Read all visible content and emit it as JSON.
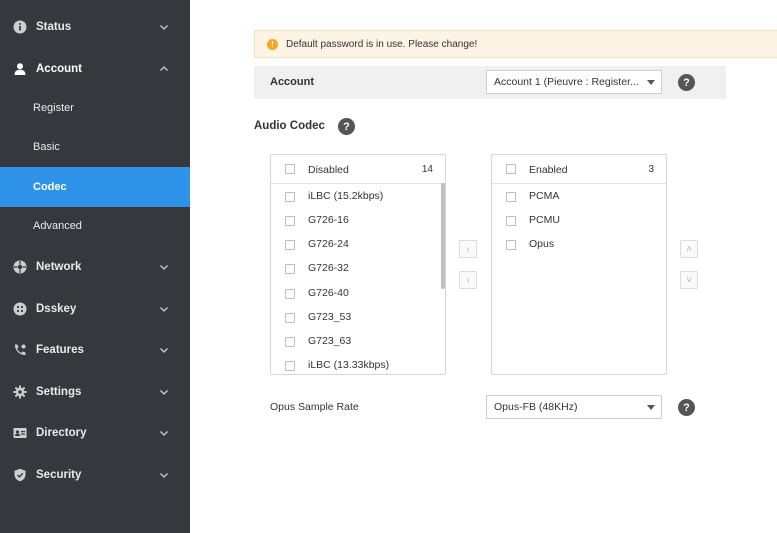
{
  "sidebar": {
    "items": [
      {
        "label": "Status",
        "icon": "info-icon"
      },
      {
        "label": "Account",
        "icon": "user-icon"
      },
      {
        "label": "Network",
        "icon": "network-icon"
      },
      {
        "label": "Dsskey",
        "icon": "dsskey-icon"
      },
      {
        "label": "Features",
        "icon": "phone-icon"
      },
      {
        "label": "Settings",
        "icon": "gear-icon"
      },
      {
        "label": "Directory",
        "icon": "directory-icon"
      },
      {
        "label": "Security",
        "icon": "shield-icon"
      }
    ],
    "account_sub": [
      {
        "label": "Register"
      },
      {
        "label": "Basic"
      },
      {
        "label": "Codec",
        "active": true
      },
      {
        "label": "Advanced"
      }
    ]
  },
  "notice": {
    "text": "Default password is in use. Please change!",
    "icon": "warning-icon",
    "color": "#f5a623"
  },
  "account": {
    "label": "Account",
    "selected": "Account 1 (Pieuvre : Register..."
  },
  "audio_codec": {
    "title": "Audio Codec",
    "disabled": {
      "title": "Disabled",
      "count": "14",
      "items": [
        "iLBC (15.2kbps)",
        "G726-16",
        "G726-24",
        "G726-32",
        "G726-40",
        "G723_53",
        "G723_63",
        "iLBC (13.33kbps)"
      ]
    },
    "enabled": {
      "title": "Enabled",
      "count": "3",
      "items": [
        "PCMA",
        "PCMU",
        "Opus"
      ]
    },
    "move_left": "‹",
    "move_right": "›",
    "move_up": "˄",
    "move_down": "˅"
  },
  "opus": {
    "label": "Opus Sample Rate",
    "selected": "Opus-FB (48KHz)"
  },
  "help_symbol": "?",
  "colors": {
    "sidebar": "#35383d",
    "active": "#2e93e8",
    "notice_bg": "#fdf4e6"
  }
}
